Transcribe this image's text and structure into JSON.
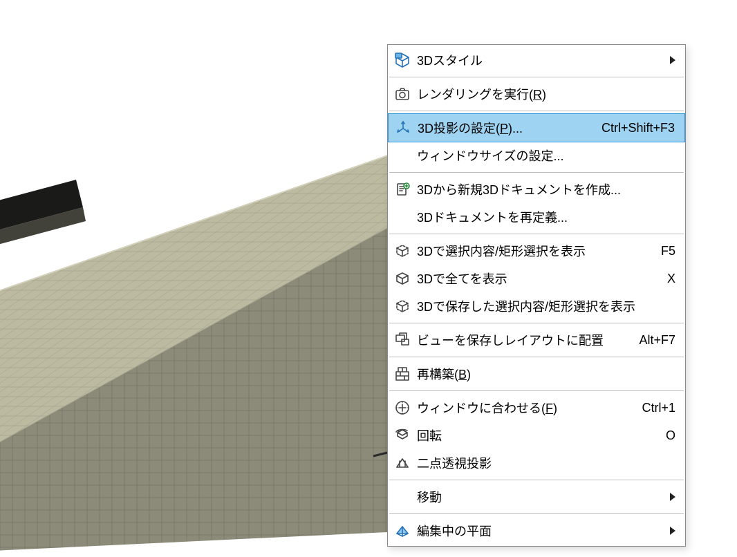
{
  "menu": {
    "items": [
      {
        "id": "style",
        "label_html": "3Dスタイル",
        "shortcut": "",
        "icon": "cube-box",
        "submenu": true
      },
      {
        "separator": true
      },
      {
        "id": "render",
        "label_html": "レンダリングを実行(<span class='mnemonic'>R</span>)",
        "shortcut": "",
        "icon": "camera",
        "submenu": false
      },
      {
        "separator": true
      },
      {
        "id": "proj",
        "label_html": "3D投影の設定(<span class='mnemonic'>P</span>)...",
        "shortcut": "Ctrl+Shift+F3",
        "icon": "axes",
        "submenu": false,
        "highlight": true
      },
      {
        "id": "winsize",
        "label_html": "ウィンドウサイズの設定...",
        "shortcut": "",
        "icon": "",
        "submenu": false
      },
      {
        "separator": true
      },
      {
        "id": "newdoc",
        "label_html": "3Dから新規3Dドキュメントを作成...",
        "shortcut": "",
        "icon": "doc-plus",
        "submenu": false
      },
      {
        "id": "redoc",
        "label_html": "3Dドキュメントを再定義...",
        "shortcut": "",
        "icon": "",
        "submenu": false
      },
      {
        "separator": true
      },
      {
        "id": "showsel",
        "label_html": "3Dで選択内容/矩形選択を表示",
        "shortcut": "F5",
        "icon": "cube-dashed",
        "submenu": false
      },
      {
        "id": "showall",
        "label_html": "3Dで全てを表示",
        "shortcut": "X",
        "icon": "cube",
        "submenu": false
      },
      {
        "id": "showsaved",
        "label_html": "3Dで保存した選択内容/矩形選択を表示",
        "shortcut": "",
        "icon": "cube-dashed",
        "submenu": false
      },
      {
        "separator": true
      },
      {
        "id": "saveview",
        "label_html": "ビューを保存しレイアウトに配置",
        "shortcut": "Alt+F7",
        "icon": "layout",
        "submenu": false
      },
      {
        "separator": true
      },
      {
        "id": "rebuild",
        "label_html": "再構築(<span class='mnemonic'>B</span>)",
        "shortcut": "",
        "icon": "bricks",
        "submenu": false
      },
      {
        "separator": true
      },
      {
        "id": "fitwin",
        "label_html": "ウィンドウに合わせる(<span class='mnemonic'>F</span>)",
        "shortcut": "Ctrl+1",
        "icon": "fit",
        "submenu": false
      },
      {
        "id": "rotate",
        "label_html": "回転",
        "shortcut": "O",
        "icon": "rotate",
        "submenu": false
      },
      {
        "id": "twopoint",
        "label_html": "二点透視投影",
        "shortcut": "",
        "icon": "perspective",
        "submenu": false
      },
      {
        "separator": true
      },
      {
        "id": "move",
        "label_html": "移動",
        "shortcut": "",
        "icon": "",
        "submenu": true
      },
      {
        "separator": true
      },
      {
        "id": "editplane",
        "label_html": "編集中の平面",
        "shortcut": "",
        "icon": "plane",
        "submenu": true
      }
    ]
  }
}
